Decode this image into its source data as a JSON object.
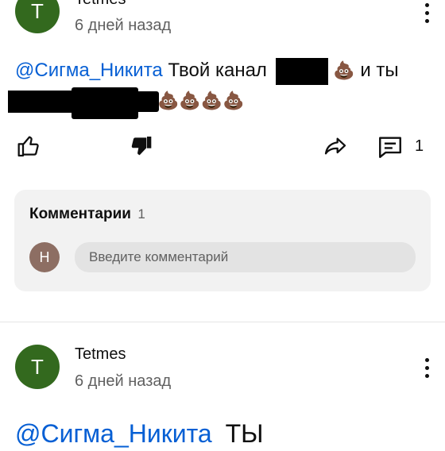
{
  "post1": {
    "avatar_letter": "T",
    "author": "Tetmes",
    "time": "6 дней назад",
    "mention": "@Сигма_Никита",
    "text_before_redaction": "Твой канал",
    "text_after_first_emoji": "и ты",
    "emoji": "💩",
    "actions": {
      "like_icon": "thumb-up-icon",
      "dislike_icon": "thumb-down-icon",
      "share_icon": "share-icon",
      "comment_icon": "comment-icon",
      "comment_count": "1"
    },
    "comments": {
      "title": "Комментарии",
      "count": "1",
      "user_avatar_letter": "Н",
      "input_placeholder": "Введите комментарий"
    }
  },
  "post2": {
    "avatar_letter": "T",
    "author": "Tetmes",
    "time": "6 дней назад",
    "mention": "@Сигма_Никита",
    "text": "ТЫ"
  },
  "colors": {
    "avatar_green": "#33691e",
    "mention_blue": "#065fd4",
    "user_avatar_brown": "#8d6e63"
  }
}
